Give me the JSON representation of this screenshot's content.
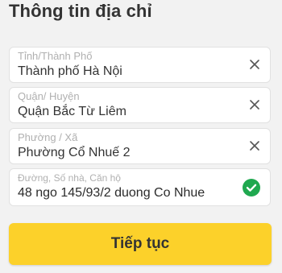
{
  "header": {
    "title": "Thông tin địa chỉ"
  },
  "form": {
    "fields": [
      {
        "label": "Tỉnh/Thành Phố",
        "value": "Thành phố Hà Nội",
        "icon": "close-icon"
      },
      {
        "label": "Quận/ Huyện",
        "value": "Quận Bắc Từ Liêm",
        "icon": "close-icon"
      },
      {
        "label": "Phường / Xã",
        "value": "Phường Cổ Nhuế 2",
        "icon": "close-icon"
      },
      {
        "label": "Đường, Số nhà, Căn hộ",
        "value": "48 ngo 145/93/2 duong Co Nhue",
        "icon": "check-circle-icon"
      }
    ],
    "submit_label": "Tiếp tục"
  },
  "colors": {
    "accent_button": "#fcd12a",
    "valid_check": "#1fa84f",
    "background": "#f2f2f2"
  }
}
